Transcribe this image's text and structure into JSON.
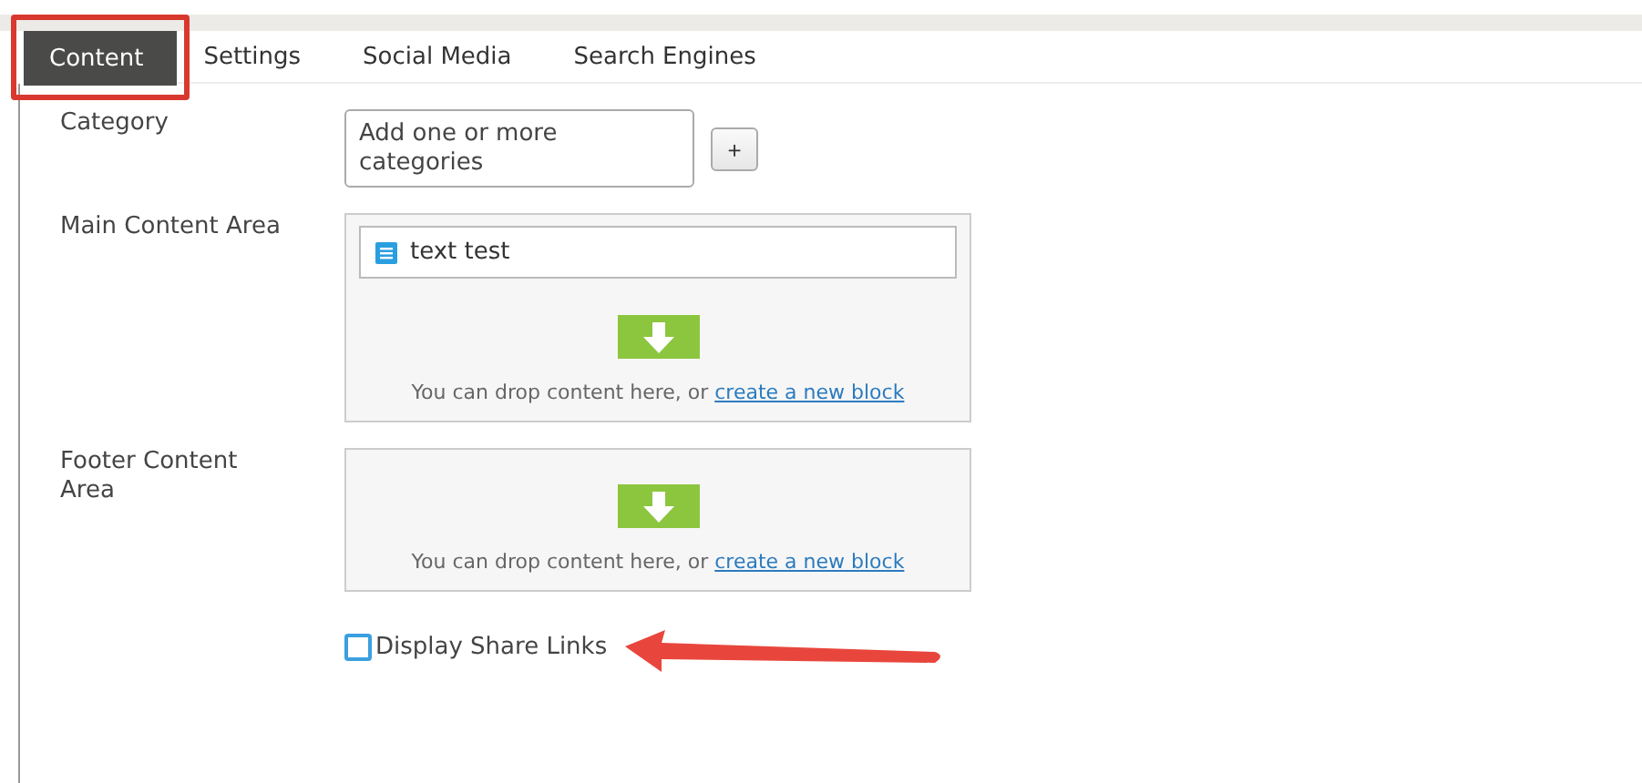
{
  "tabs": [
    {
      "label": "Content",
      "selected": true,
      "highlighted": true
    },
    {
      "label": "Settings",
      "selected": false,
      "highlighted": false
    },
    {
      "label": "Social Media",
      "selected": false,
      "highlighted": false
    },
    {
      "label": "Search Engines",
      "selected": false,
      "highlighted": false
    }
  ],
  "fields": [
    {
      "kind": "category",
      "label": "Category",
      "placeholder": "Add one or more categories",
      "button": "+"
    },
    {
      "kind": "contentarea",
      "label": "Main Content Area",
      "blocks": [
        "text test"
      ],
      "drop_text": "You can drop content here, or ",
      "drop_link": "create a new block"
    },
    {
      "kind": "contentarea",
      "label": "Footer Content Area",
      "drop_text": "You can drop content here, or ",
      "drop_link": "create a new block"
    },
    {
      "kind": "checkbox",
      "label": "Display Share Links",
      "checked": false
    }
  ]
}
